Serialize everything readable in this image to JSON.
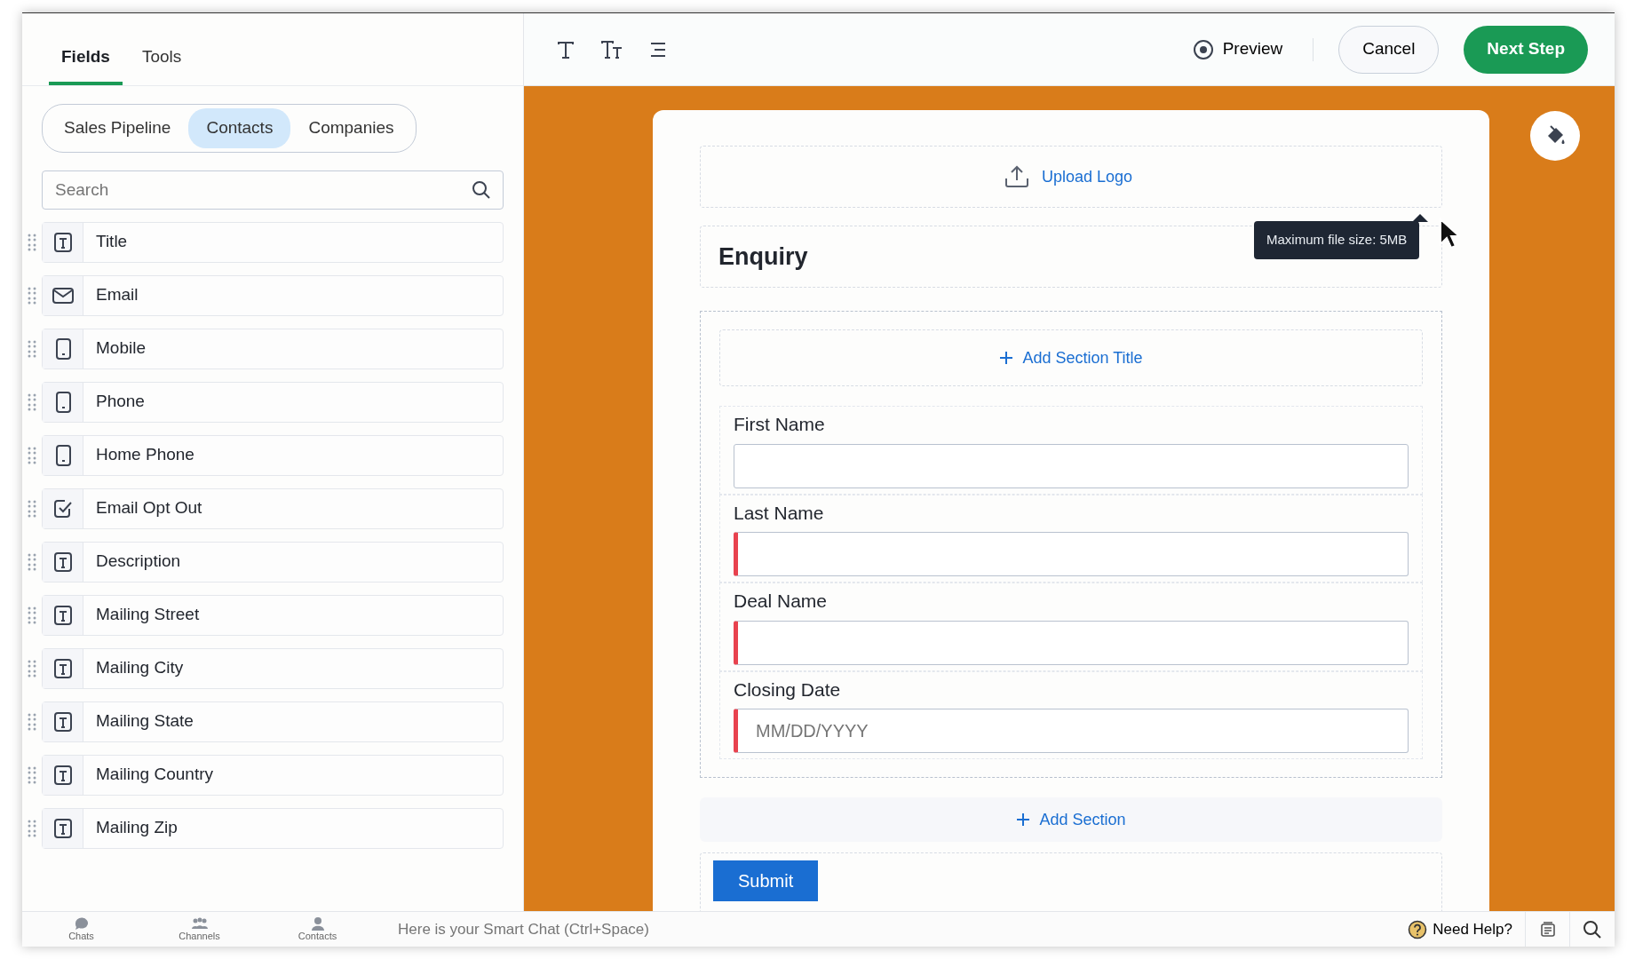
{
  "sidebar": {
    "tabs": [
      {
        "label": "Fields",
        "selected": true
      },
      {
        "label": "Tools",
        "selected": false
      }
    ],
    "modules": [
      {
        "label": "Sales Pipeline",
        "selected": false
      },
      {
        "label": "Contacts",
        "selected": true
      },
      {
        "label": "Companies",
        "selected": false
      }
    ],
    "search": {
      "placeholder": "Search"
    },
    "fields": [
      {
        "label": "Title",
        "kind": "text"
      },
      {
        "label": "Email",
        "kind": "email"
      },
      {
        "label": "Mobile",
        "kind": "phone"
      },
      {
        "label": "Phone",
        "kind": "phone"
      },
      {
        "label": "Home Phone",
        "kind": "phone"
      },
      {
        "label": "Email Opt Out",
        "kind": "checkbox"
      },
      {
        "label": "Description",
        "kind": "text"
      },
      {
        "label": "Mailing Street",
        "kind": "text"
      },
      {
        "label": "Mailing City",
        "kind": "text"
      },
      {
        "label": "Mailing State",
        "kind": "text"
      },
      {
        "label": "Mailing Country",
        "kind": "text"
      },
      {
        "label": "Mailing Zip",
        "kind": "text"
      }
    ]
  },
  "toolbar": {
    "preview": "Preview",
    "cancel": "Cancel",
    "next": "Next Step"
  },
  "form": {
    "upload_logo": "Upload Logo",
    "tooltip": "Maximum file size: 5MB",
    "title": "Enquiry",
    "add_section_title": "Add Section Title",
    "fields": [
      {
        "label": "First Name",
        "required": false
      },
      {
        "label": "Last Name",
        "required": true
      },
      {
        "label": "Deal Name",
        "required": true
      },
      {
        "label": "Closing Date",
        "required": true,
        "placeholder": "MM/DD/YYYY"
      }
    ],
    "add_section": "Add Section",
    "submit": "Submit"
  },
  "bottom_bar": {
    "tabs": [
      "Chats",
      "Channels",
      "Contacts"
    ],
    "chat_placeholder": "Here is your Smart Chat (Ctrl+Space)",
    "help": "Need Help?"
  }
}
